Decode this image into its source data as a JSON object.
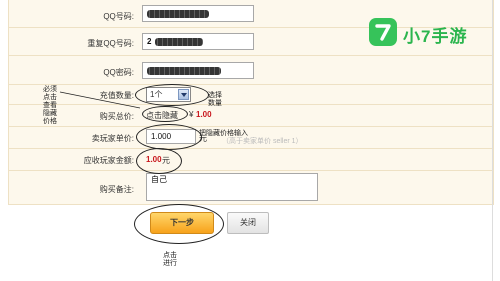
{
  "form": {
    "qq_label": "QQ号码:",
    "qq_repeat_label": "重复QQ号码:",
    "qq_repeat_value": "2",
    "qq_password_label": "QQ密码:",
    "quantity_label": "充值数量:",
    "quantity_value": "1个",
    "total_label": "购买总价:",
    "hidden_button": "点击隐藏",
    "total_prefix": "¥",
    "total_value": "1.00",
    "unit_price_label": "卖玩家单价:",
    "unit_price_value": "1.000",
    "unit_price_suffix": "元",
    "receivable_label": "应收玩家金额:",
    "receivable_value": "1.00",
    "receivable_unit": "元",
    "note_label": "购买备注:",
    "note_value": "自己"
  },
  "buttons": {
    "next": "下一步",
    "close": "关闭"
  },
  "annotations": {
    "left_note": "必须点击查看隐藏价格",
    "quantity_note": "选择数量",
    "price_note": "把隐藏价格输入",
    "ghost_note": "（高于卖家单价 seller 1）",
    "click_note": "点击进行"
  },
  "brand": {
    "name": "小7手游",
    "color": "#36c35a"
  }
}
